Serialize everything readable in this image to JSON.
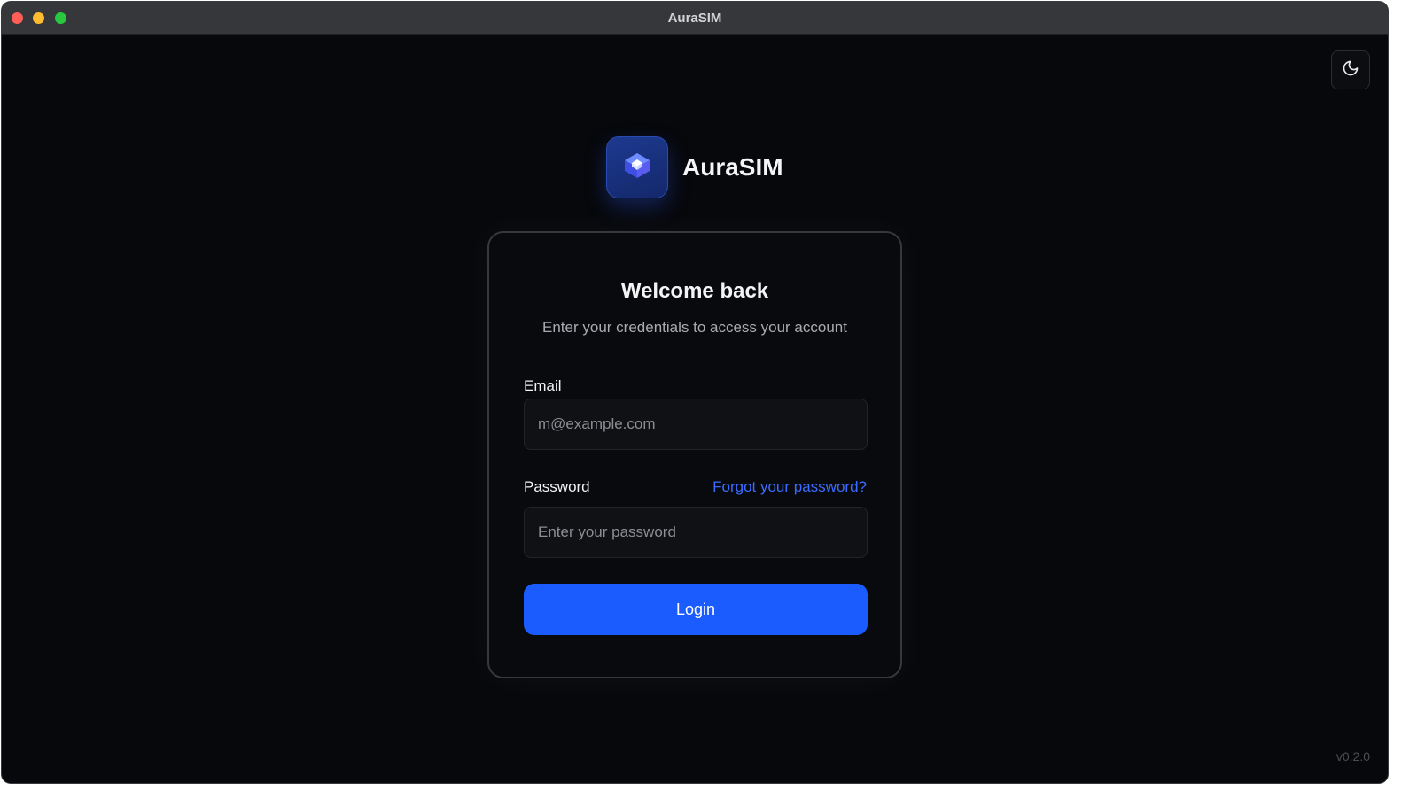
{
  "window": {
    "title": "AuraSIM"
  },
  "theme_toggle": {
    "icon": "moon-icon"
  },
  "brand": {
    "name": "AuraSIM",
    "logo_icon": "cube-icon",
    "accent": "#1a5cff"
  },
  "login_card": {
    "title": "Welcome back",
    "subtitle": "Enter your credentials to access your account",
    "email_label": "Email",
    "email_placeholder": "m@example.com",
    "email_value": "",
    "password_label": "Password",
    "forgot_link": "Forgot your password?",
    "password_placeholder": "Enter your password",
    "password_value": "",
    "login_label": "Login"
  },
  "footer": {
    "version": "v0.2.0"
  }
}
